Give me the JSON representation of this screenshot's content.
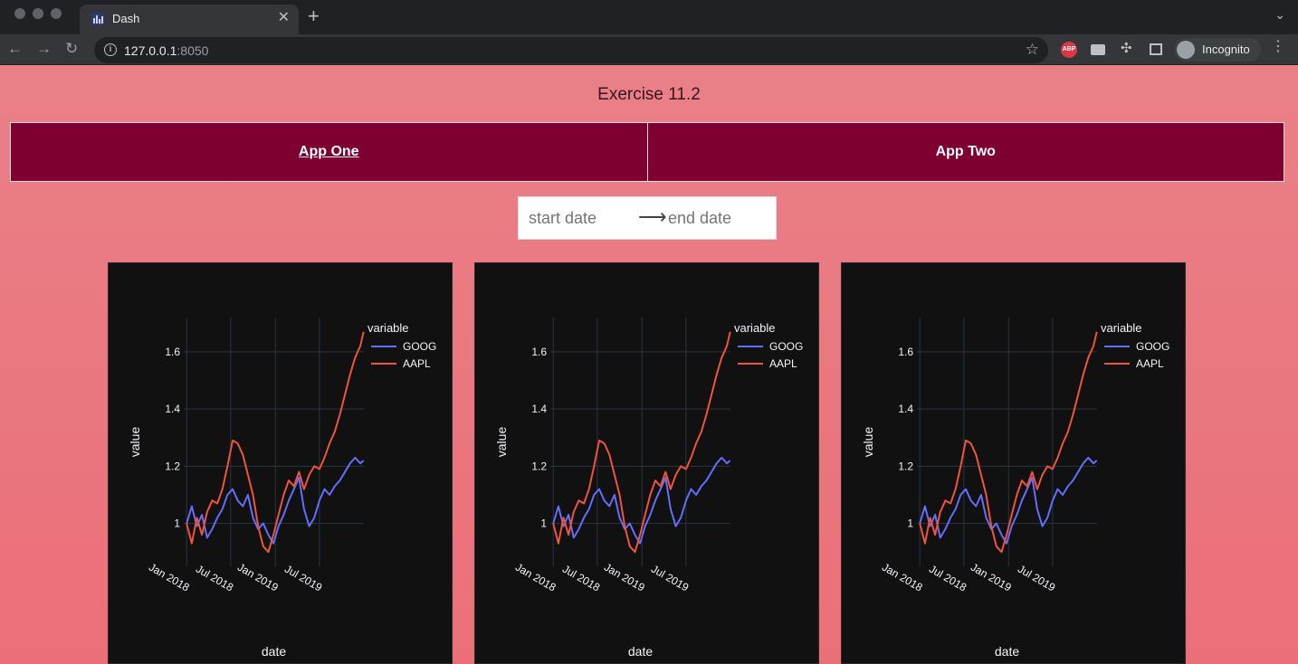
{
  "browser": {
    "tab_title": "Dash",
    "url_host": "127.0.0.1",
    "url_port": ":8050",
    "profile_label": "Incognito",
    "abp_label": "ABP"
  },
  "page": {
    "title": "Exercise 11.2",
    "tabs": [
      {
        "label": "App One",
        "active": true
      },
      {
        "label": "App Two",
        "active": false
      }
    ],
    "date_range": {
      "start_placeholder": "start date",
      "end_placeholder": "end date",
      "arrow": "⟶"
    },
    "background_color": "#ea7982",
    "tab_color": "#7d0031"
  },
  "chart_data": [
    {
      "type": "line",
      "xlabel": "date",
      "ylabel": "value",
      "legend_title": "variable",
      "legend_position": "top-right",
      "grid": true,
      "ylim": [
        0.85,
        1.72
      ],
      "xlim": [
        "2017-12-20",
        "2019-12-31"
      ],
      "x_ticks": [
        "2018-01-01",
        "2018-07-01",
        "2019-01-01",
        "2019-07-01"
      ],
      "x_tick_labels": [
        "Jan 2018",
        "Jul 2018",
        "Jan 2019",
        "Jul 2019"
      ],
      "y_ticks": [
        1,
        1.2,
        1.4,
        1.6
      ],
      "y_tick_labels": [
        "1",
        "1.2",
        "1.4",
        "1.6"
      ],
      "series": [
        {
          "name": "GOOG",
          "color": "#636efa",
          "x": [
            "2018-01-01",
            "2018-01-22",
            "2018-02-12",
            "2018-03-05",
            "2018-03-26",
            "2018-04-16",
            "2018-05-07",
            "2018-05-28",
            "2018-06-18",
            "2018-07-09",
            "2018-07-30",
            "2018-08-20",
            "2018-09-10",
            "2018-10-01",
            "2018-10-22",
            "2018-11-12",
            "2018-12-03",
            "2018-12-24",
            "2019-01-14",
            "2019-02-04",
            "2019-02-25",
            "2019-03-18",
            "2019-04-08",
            "2019-04-29",
            "2019-05-20",
            "2019-06-10",
            "2019-07-01",
            "2019-07-22",
            "2019-08-12",
            "2019-09-02",
            "2019-09-23",
            "2019-10-14",
            "2019-11-04",
            "2019-11-25",
            "2019-12-16",
            "2019-12-30"
          ],
          "values": [
            1.0,
            1.06,
            0.99,
            1.03,
            0.95,
            0.98,
            1.02,
            1.05,
            1.1,
            1.12,
            1.08,
            1.06,
            1.1,
            1.02,
            0.98,
            1.0,
            0.96,
            0.93,
            0.99,
            1.03,
            1.08,
            1.12,
            1.16,
            1.05,
            0.99,
            1.02,
            1.08,
            1.12,
            1.1,
            1.13,
            1.15,
            1.18,
            1.21,
            1.23,
            1.21,
            1.22
          ]
        },
        {
          "name": "AAPL",
          "color": "#ef553b",
          "x": [
            "2018-01-01",
            "2018-01-22",
            "2018-02-12",
            "2018-03-05",
            "2018-03-26",
            "2018-04-16",
            "2018-05-07",
            "2018-05-28",
            "2018-06-18",
            "2018-07-09",
            "2018-07-30",
            "2018-08-20",
            "2018-09-10",
            "2018-10-01",
            "2018-10-22",
            "2018-11-12",
            "2018-12-03",
            "2018-12-24",
            "2019-01-14",
            "2019-02-04",
            "2019-02-25",
            "2019-03-18",
            "2019-04-08",
            "2019-04-29",
            "2019-05-20",
            "2019-06-10",
            "2019-07-01",
            "2019-07-22",
            "2019-08-12",
            "2019-09-02",
            "2019-09-23",
            "2019-10-14",
            "2019-11-04",
            "2019-11-25",
            "2019-12-16",
            "2019-12-30"
          ],
          "values": [
            1.0,
            0.93,
            1.02,
            0.96,
            1.04,
            1.08,
            1.07,
            1.12,
            1.2,
            1.29,
            1.28,
            1.24,
            1.17,
            1.1,
            0.99,
            0.92,
            0.9,
            0.96,
            1.03,
            1.1,
            1.15,
            1.13,
            1.18,
            1.12,
            1.17,
            1.2,
            1.19,
            1.23,
            1.28,
            1.32,
            1.38,
            1.45,
            1.52,
            1.58,
            1.62,
            1.67
          ]
        }
      ]
    },
    {
      "type": "line",
      "xlabel": "date",
      "ylabel": "value",
      "legend_title": "variable",
      "legend_position": "top-right",
      "grid": true,
      "ylim": [
        0.85,
        1.72
      ],
      "xlim": [
        "2017-12-20",
        "2019-12-31"
      ],
      "x_ticks": [
        "2018-01-01",
        "2018-07-01",
        "2019-01-01",
        "2019-07-01"
      ],
      "x_tick_labels": [
        "Jan 2018",
        "Jul 2018",
        "Jan 2019",
        "Jul 2019"
      ],
      "y_ticks": [
        1,
        1.2,
        1.4,
        1.6
      ],
      "y_tick_labels": [
        "1",
        "1.2",
        "1.4",
        "1.6"
      ],
      "series": [
        {
          "name": "GOOG",
          "color": "#636efa",
          "x": [
            "2018-01-01",
            "2018-01-22",
            "2018-02-12",
            "2018-03-05",
            "2018-03-26",
            "2018-04-16",
            "2018-05-07",
            "2018-05-28",
            "2018-06-18",
            "2018-07-09",
            "2018-07-30",
            "2018-08-20",
            "2018-09-10",
            "2018-10-01",
            "2018-10-22",
            "2018-11-12",
            "2018-12-03",
            "2018-12-24",
            "2019-01-14",
            "2019-02-04",
            "2019-02-25",
            "2019-03-18",
            "2019-04-08",
            "2019-04-29",
            "2019-05-20",
            "2019-06-10",
            "2019-07-01",
            "2019-07-22",
            "2019-08-12",
            "2019-09-02",
            "2019-09-23",
            "2019-10-14",
            "2019-11-04",
            "2019-11-25",
            "2019-12-16",
            "2019-12-30"
          ],
          "values": [
            1.0,
            1.06,
            0.99,
            1.03,
            0.95,
            0.98,
            1.02,
            1.05,
            1.1,
            1.12,
            1.08,
            1.06,
            1.1,
            1.02,
            0.98,
            1.0,
            0.96,
            0.93,
            0.99,
            1.03,
            1.08,
            1.12,
            1.16,
            1.05,
            0.99,
            1.02,
            1.08,
            1.12,
            1.1,
            1.13,
            1.15,
            1.18,
            1.21,
            1.23,
            1.21,
            1.22
          ]
        },
        {
          "name": "AAPL",
          "color": "#ef553b",
          "x": [
            "2018-01-01",
            "2018-01-22",
            "2018-02-12",
            "2018-03-05",
            "2018-03-26",
            "2018-04-16",
            "2018-05-07",
            "2018-05-28",
            "2018-06-18",
            "2018-07-09",
            "2018-07-30",
            "2018-08-20",
            "2018-09-10",
            "2018-10-01",
            "2018-10-22",
            "2018-11-12",
            "2018-12-03",
            "2018-12-24",
            "2019-01-14",
            "2019-02-04",
            "2019-02-25",
            "2019-03-18",
            "2019-04-08",
            "2019-04-29",
            "2019-05-20",
            "2019-06-10",
            "2019-07-01",
            "2019-07-22",
            "2019-08-12",
            "2019-09-02",
            "2019-09-23",
            "2019-10-14",
            "2019-11-04",
            "2019-11-25",
            "2019-12-16",
            "2019-12-30"
          ],
          "values": [
            1.0,
            0.93,
            1.02,
            0.96,
            1.04,
            1.08,
            1.07,
            1.12,
            1.2,
            1.29,
            1.28,
            1.24,
            1.17,
            1.1,
            0.99,
            0.92,
            0.9,
            0.96,
            1.03,
            1.1,
            1.15,
            1.13,
            1.18,
            1.12,
            1.17,
            1.2,
            1.19,
            1.23,
            1.28,
            1.32,
            1.38,
            1.45,
            1.52,
            1.58,
            1.62,
            1.67
          ]
        }
      ]
    },
    {
      "type": "line",
      "xlabel": "date",
      "ylabel": "value",
      "legend_title": "variable",
      "legend_position": "top-right",
      "grid": true,
      "ylim": [
        0.85,
        1.72
      ],
      "xlim": [
        "2017-12-20",
        "2019-12-31"
      ],
      "x_ticks": [
        "2018-01-01",
        "2018-07-01",
        "2019-01-01",
        "2019-07-01"
      ],
      "x_tick_labels": [
        "Jan 2018",
        "Jul 2018",
        "Jan 2019",
        "Jul 2019"
      ],
      "y_ticks": [
        1,
        1.2,
        1.4,
        1.6
      ],
      "y_tick_labels": [
        "1",
        "1.2",
        "1.4",
        "1.6"
      ],
      "series": [
        {
          "name": "GOOG",
          "color": "#636efa",
          "x": [
            "2018-01-01",
            "2018-01-22",
            "2018-02-12",
            "2018-03-05",
            "2018-03-26",
            "2018-04-16",
            "2018-05-07",
            "2018-05-28",
            "2018-06-18",
            "2018-07-09",
            "2018-07-30",
            "2018-08-20",
            "2018-09-10",
            "2018-10-01",
            "2018-10-22",
            "2018-11-12",
            "2018-12-03",
            "2018-12-24",
            "2019-01-14",
            "2019-02-04",
            "2019-02-25",
            "2019-03-18",
            "2019-04-08",
            "2019-04-29",
            "2019-05-20",
            "2019-06-10",
            "2019-07-01",
            "2019-07-22",
            "2019-08-12",
            "2019-09-02",
            "2019-09-23",
            "2019-10-14",
            "2019-11-04",
            "2019-11-25",
            "2019-12-16",
            "2019-12-30"
          ],
          "values": [
            1.0,
            1.06,
            0.99,
            1.03,
            0.95,
            0.98,
            1.02,
            1.05,
            1.1,
            1.12,
            1.08,
            1.06,
            1.1,
            1.02,
            0.98,
            1.0,
            0.96,
            0.93,
            0.99,
            1.03,
            1.08,
            1.12,
            1.16,
            1.05,
            0.99,
            1.02,
            1.08,
            1.12,
            1.1,
            1.13,
            1.15,
            1.18,
            1.21,
            1.23,
            1.21,
            1.22
          ]
        },
        {
          "name": "AAPL",
          "color": "#ef553b",
          "x": [
            "2018-01-01",
            "2018-01-22",
            "2018-02-12",
            "2018-03-05",
            "2018-03-26",
            "2018-04-16",
            "2018-05-07",
            "2018-05-28",
            "2018-06-18",
            "2018-07-09",
            "2018-07-30",
            "2018-08-20",
            "2018-09-10",
            "2018-10-01",
            "2018-10-22",
            "2018-11-12",
            "2018-12-03",
            "2018-12-24",
            "2019-01-14",
            "2019-02-04",
            "2019-02-25",
            "2019-03-18",
            "2019-04-08",
            "2019-04-29",
            "2019-05-20",
            "2019-06-10",
            "2019-07-01",
            "2019-07-22",
            "2019-08-12",
            "2019-09-02",
            "2019-09-23",
            "2019-10-14",
            "2019-11-04",
            "2019-11-25",
            "2019-12-16",
            "2019-12-30"
          ],
          "values": [
            1.0,
            0.93,
            1.02,
            0.96,
            1.04,
            1.08,
            1.07,
            1.12,
            1.2,
            1.29,
            1.28,
            1.24,
            1.17,
            1.1,
            0.99,
            0.92,
            0.9,
            0.96,
            1.03,
            1.1,
            1.15,
            1.13,
            1.18,
            1.12,
            1.17,
            1.2,
            1.19,
            1.23,
            1.28,
            1.32,
            1.38,
            1.45,
            1.52,
            1.58,
            1.62,
            1.67
          ]
        }
      ]
    }
  ]
}
